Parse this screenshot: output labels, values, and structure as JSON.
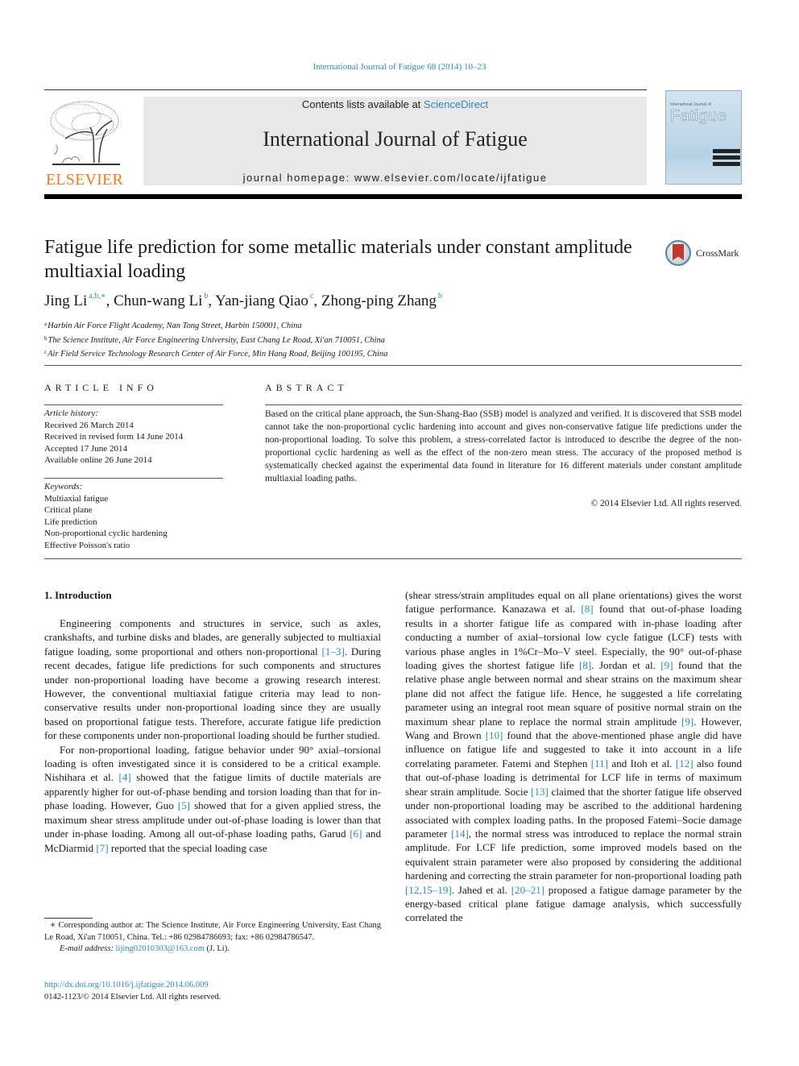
{
  "header": {
    "running_head": "International Journal of Fatigue 68 (2014) 10–23",
    "contents_prefix": "Contents lists available at ",
    "contents_link": "ScienceDirect",
    "journal_name": "International Journal of Fatigue",
    "homepage_prefix": "journal homepage: ",
    "homepage_url": "www.elsevier.com/locate/ijfatigue",
    "publisher_logo_text": "ELSEVIER",
    "cover": {
      "small_title": "International Journal of",
      "big_title": "Fatigue"
    },
    "crossmark_label": "CrossMark"
  },
  "article": {
    "title": "Fatigue life prediction for some metallic materials under constant amplitude multiaxial loading",
    "authors": [
      {
        "name": "Jing Li",
        "sup": "a,b,∗"
      },
      {
        "name": "Chun-wang Li",
        "sup": "b"
      },
      {
        "name": "Yan-jiang Qiao",
        "sup": "c"
      },
      {
        "name": "Zhong-ping Zhang",
        "sup": "b"
      }
    ],
    "affiliations": [
      {
        "key": "a",
        "text": "Harbin Air Force Flight Academy, Nan Tong Street, Harbin 150001, China"
      },
      {
        "key": "b",
        "text": "The Science Institute, Air Force Engineering University, East Chang Le Road, Xi'an 710051, China"
      },
      {
        "key": "c",
        "text": "Air Field Service Technology Research Center of Air Force, Min Hang Road, Beijing 100195, China"
      }
    ]
  },
  "article_info": {
    "heading": "ARTICLE INFO",
    "history_label": "Article history:",
    "history": [
      "Received 26 March 2014",
      "Received in revised form 14 June 2014",
      "Accepted 17 June 2014",
      "Available online 26 June 2014"
    ],
    "keywords_label": "Keywords:",
    "keywords": [
      "Multiaxial fatigue",
      "Critical plane",
      "Life prediction",
      "Non-proportional cyclic hardening",
      "Effective Poisson's ratio"
    ]
  },
  "abstract": {
    "heading": "ABSTRACT",
    "text": "Based on the critical plane approach, the Sun-Shang-Bao (SSB) model is analyzed and verified. It is discovered that SSB model cannot take the non-proportional cyclic hardening into account and gives non-conservative fatigue life predictions under the non-proportional loading. To solve this problem, a stress-correlated factor is introduced to describe the degree of the non-proportional cyclic hardening as well as the effect of the non-zero mean stress. The accuracy of the proposed method is systematically checked against the experimental data found in literature for 16 different materials under constant amplitude multiaxial loading paths.",
    "copyright": "© 2014 Elsevier Ltd. All rights reserved."
  },
  "body": {
    "section_heading": "1. Introduction",
    "p1": [
      {
        "t": "Engineering components and structures in service, such as axles, crankshafts, and turbine disks and blades, are generally subjected to multiaxial fatigue loading, some proportional and others non-proportional "
      },
      {
        "ref": "[1–3]"
      },
      {
        "t": ". During recent decades, fatigue life predictions for such components and structures under non-proportional loading have become a growing research interest. However, the conventional multiaxial fatigue criteria may lead to non-conservative results under non-proportional loading since they are usually based on proportional fatigue tests. Therefore, accurate fatigue life prediction for these components under non-proportional loading should be further studied."
      }
    ],
    "p2": [
      {
        "t": "For non-proportional loading, fatigue behavior under 90° axial–torsional loading is often investigated since it is considered to be a critical example. Nishihara et al. "
      },
      {
        "ref": "[4]"
      },
      {
        "t": " showed that the fatigue limits of ductile materials are apparently higher for out-of-phase bending and torsion loading than that for in-phase loading. However, Guo "
      },
      {
        "ref": "[5]"
      },
      {
        "t": " showed that for a given applied stress, the maximum shear stress amplitude under out-of-phase loading is lower than that under in-phase loading. Among all out-of-phase loading paths, Garud "
      },
      {
        "ref": "[6]"
      },
      {
        "t": " and McDiarmid "
      },
      {
        "ref": "[7]"
      },
      {
        "t": " reported that the special loading case"
      }
    ],
    "p3": [
      {
        "t": "(shear stress/strain amplitudes equal on all plane orientations) gives the worst fatigue performance. Kanazawa et al. "
      },
      {
        "ref": "[8]"
      },
      {
        "t": " found that out-of-phase loading results in a shorter fatigue life as compared with in-phase loading after conducting a number of axial–torsional low cycle fatigue (LCF) tests with various phase angles in 1%Cr–Mo–V steel. Especially, the 90° out-of-phase loading gives the shortest fatigue life "
      },
      {
        "ref": "[8]"
      },
      {
        "t": ". Jordan et al. "
      },
      {
        "ref": "[9]"
      },
      {
        "t": " found that the relative phase angle between normal and shear strains on the maximum shear plane did not affect the fatigue life. Hence, he suggested a life correlating parameter using an integral root mean square of positive normal strain on the maximum shear plane to replace the normal strain amplitude "
      },
      {
        "ref": "[9]"
      },
      {
        "t": ". However, Wang and Brown "
      },
      {
        "ref": "[10]"
      },
      {
        "t": " found that the above-mentioned phase angle did have influence on fatigue life and suggested to take it into account in a life correlating parameter. Fatemi and Stephen "
      },
      {
        "ref": "[11]"
      },
      {
        "t": " and Itoh et al. "
      },
      {
        "ref": "[12]"
      },
      {
        "t": " also found that out-of-phase loading is detrimental for LCF life in terms of maximum shear strain amplitude. Socie "
      },
      {
        "ref": "[13]"
      },
      {
        "t": " claimed that the shorter fatigue life observed under non-proportional loading may be ascribed to the additional hardening associated with complex loading paths. In the proposed Fatemi–Socie damage parameter "
      },
      {
        "ref": "[14]"
      },
      {
        "t": ", the normal stress was introduced to replace the normal strain amplitude. For LCF life prediction, some improved models based on the equivalent strain parameter were also proposed by considering the additional hardening and correcting the strain parameter for non-proportional loading path "
      },
      {
        "ref": "[12,15–19]"
      },
      {
        "t": ". Jahed et al. "
      },
      {
        "ref": "[20–21]"
      },
      {
        "t": " proposed a fatigue damage parameter by the energy-based critical plane fatigue damage analysis, which successfully correlated the"
      }
    ]
  },
  "footnote": {
    "star": "∗",
    "corresponding": "Corresponding author at: The Science Institute, Air Force Engineering University, East Chang Le Road, Xi'an 710051, China. Tel.: +86 02984786693; fax: +86 02984786547.",
    "email_label": "E-mail address: ",
    "email": "lijing02010303@163.com",
    "email_suffix": " (J. Li).",
    "doi": "http://dx.doi.org/10.1016/j.ijfatigue.2014.06.009",
    "issn_line": "0142-1123/© 2014 Elsevier Ltd. All rights reserved."
  }
}
